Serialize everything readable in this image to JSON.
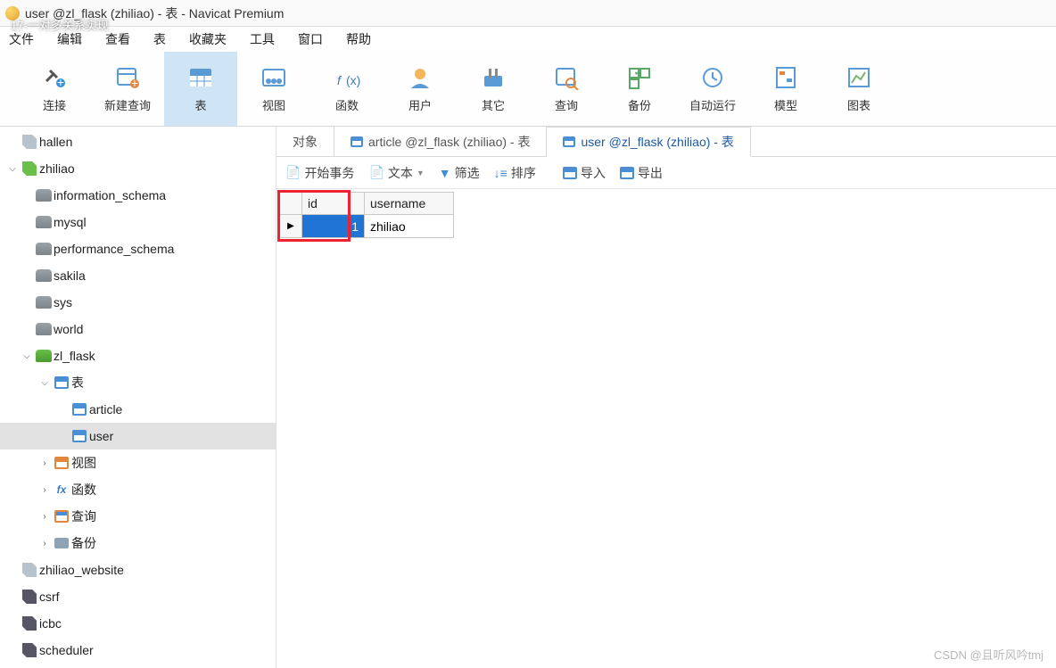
{
  "window": {
    "title": "user @zl_flask (zhiliao) - 表 - Navicat Premium"
  },
  "overlay": "17-一对多关系实现",
  "menu": [
    "文件",
    "编辑",
    "查看",
    "表",
    "收藏夹",
    "工具",
    "窗口",
    "帮助"
  ],
  "toolbar": [
    {
      "label": "连接",
      "icon": "plug"
    },
    {
      "label": "新建查询",
      "icon": "newquery"
    },
    {
      "label": "表",
      "icon": "table",
      "active": true
    },
    {
      "label": "视图",
      "icon": "view"
    },
    {
      "label": "函数",
      "icon": "fx"
    },
    {
      "label": "用户",
      "icon": "user"
    },
    {
      "label": "其它",
      "icon": "other"
    },
    {
      "label": "查询",
      "icon": "query"
    },
    {
      "label": "备份",
      "icon": "backup"
    },
    {
      "label": "自动运行",
      "icon": "auto"
    },
    {
      "label": "模型",
      "icon": "model"
    },
    {
      "label": "图表",
      "icon": "chart"
    }
  ],
  "tree": [
    {
      "label": "hallen",
      "type": "conn",
      "indent": 0,
      "expander": ""
    },
    {
      "label": "zhiliao",
      "type": "conn-open",
      "indent": 0,
      "expander": "v"
    },
    {
      "label": "information_schema",
      "type": "db",
      "indent": 1,
      "expander": ""
    },
    {
      "label": "mysql",
      "type": "db",
      "indent": 1,
      "expander": ""
    },
    {
      "label": "performance_schema",
      "type": "db",
      "indent": 1,
      "expander": ""
    },
    {
      "label": "sakila",
      "type": "db",
      "indent": 1,
      "expander": ""
    },
    {
      "label": "sys",
      "type": "db",
      "indent": 1,
      "expander": ""
    },
    {
      "label": "world",
      "type": "db",
      "indent": 1,
      "expander": ""
    },
    {
      "label": "zl_flask",
      "type": "db-open",
      "indent": 1,
      "expander": "v"
    },
    {
      "label": "表",
      "type": "tables",
      "indent": 2,
      "expander": "v"
    },
    {
      "label": "article",
      "type": "table",
      "indent": 3,
      "expander": ""
    },
    {
      "label": "user",
      "type": "table",
      "indent": 3,
      "expander": "",
      "selected": true
    },
    {
      "label": "视图",
      "type": "views",
      "indent": 2,
      "expander": ">"
    },
    {
      "label": "函数",
      "type": "fx",
      "indent": 2,
      "expander": ">"
    },
    {
      "label": "查询",
      "type": "query",
      "indent": 2,
      "expander": ">"
    },
    {
      "label": "备份",
      "type": "backup",
      "indent": 2,
      "expander": ">"
    },
    {
      "label": "zhiliao_website",
      "type": "conn",
      "indent": 0,
      "expander": ""
    },
    {
      "label": "csrf",
      "type": "conn-dark",
      "indent": 0,
      "expander": ""
    },
    {
      "label": "icbc",
      "type": "conn-dark",
      "indent": 0,
      "expander": ""
    },
    {
      "label": "scheduler",
      "type": "conn-dark",
      "indent": 0,
      "expander": ""
    }
  ],
  "tabs": [
    {
      "label": "对象",
      "active": false,
      "icon": ""
    },
    {
      "label": "article @zl_flask (zhiliao) - 表",
      "active": false,
      "icon": "table"
    },
    {
      "label": "user @zl_flask (zhiliao) - 表",
      "active": true,
      "icon": "table"
    }
  ],
  "subtoolbar": {
    "begin": "开始事务",
    "text": "文本",
    "filter": "筛选",
    "sort": "排序",
    "import": "导入",
    "export": "导出"
  },
  "grid": {
    "headers": [
      "id",
      "username"
    ],
    "rows": [
      {
        "id": "1",
        "username": "zhiliao"
      }
    ]
  },
  "watermark": "CSDN @且听风吟tmj"
}
